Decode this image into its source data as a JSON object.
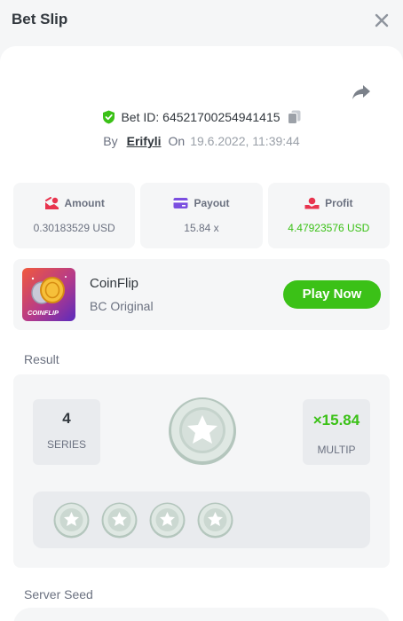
{
  "header": {
    "title": "Bet Slip"
  },
  "bet": {
    "id_text": "Bet ID: 64521700254941415",
    "by_label": "By",
    "user": "Erifyli",
    "on_label": "On",
    "date": "19.6.2022, 11:39:44"
  },
  "stats": {
    "amount_label": "Amount",
    "amount_value": "0.30183529 USD",
    "payout_label": "Payout",
    "payout_value": "15.84 x",
    "profit_label": "Profit",
    "profit_value": "4.47923576 USD"
  },
  "game": {
    "name": "CoinFlip",
    "subtitle": "BC Original",
    "thumb_text": "COINFLIP",
    "play_label": "Play Now"
  },
  "result": {
    "section_label": "Result",
    "series_value": "4",
    "series_label": "SERIES",
    "multiplier_value": "×15.84",
    "multiplier_label": "MULTIP"
  },
  "server_seed": {
    "label": "Server Seed"
  },
  "colors": {
    "accent_green": "#3bc117",
    "brand_red": "#e8344e",
    "coin_silver": "#c5d3cc"
  },
  "icons": [
    "close-icon",
    "share-icon",
    "verified-shield-icon",
    "copy-icon",
    "amount-icon",
    "payout-card-icon",
    "profit-icon",
    "star-coin-icon"
  ]
}
